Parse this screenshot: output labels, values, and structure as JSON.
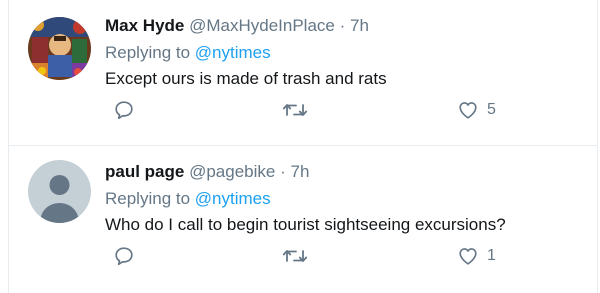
{
  "tweets": [
    {
      "name": "Max Hyde",
      "handle": "@MaxHydeInPlace",
      "dot": "·",
      "time": "7h",
      "replying_prefix": "Replying to",
      "replying_to": "@nytimes",
      "text": "Except ours is made of trash and rats",
      "like_count": "5",
      "avatar": "illustrated-avatar"
    },
    {
      "name": "paul page",
      "handle": "@pagebike",
      "dot": "·",
      "time": "7h",
      "replying_prefix": "Replying to",
      "replying_to": "@nytimes",
      "text": "Who do I call to begin tourist sightseeing excursions?",
      "like_count": "1",
      "avatar": "default-profile-avatar"
    }
  ],
  "icons": {
    "reply": "reply-icon",
    "retweet": "retweet-icon",
    "like": "heart-icon"
  },
  "colors": {
    "link": "#1da1f2",
    "muted": "#657786",
    "text": "#14171a",
    "divider": "#e6ecf0"
  }
}
